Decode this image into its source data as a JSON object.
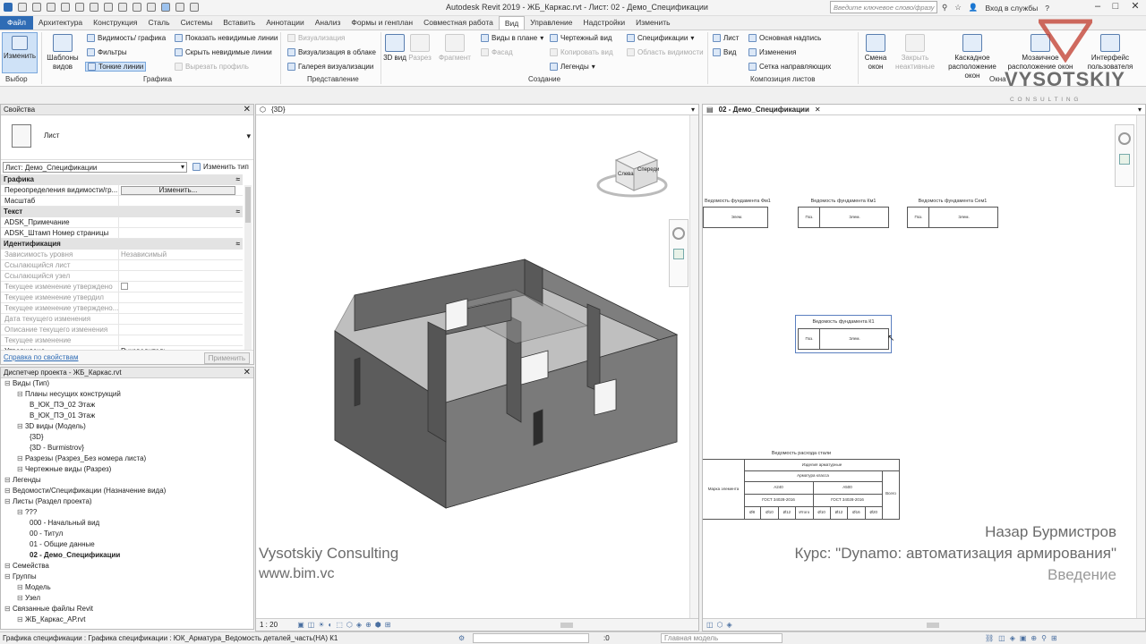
{
  "titlebar": {
    "title": "Autodesk Revit 2019 - ЖБ_Каркас.rvt - Лист: 02 - Демо_Спецификации",
    "search_placeholder": "Введите ключевое слово/фразу",
    "signin": "Вход в службы",
    "help": "?"
  },
  "menu": {
    "tabs": [
      "Файл",
      "Архитектура",
      "Конструкция",
      "Сталь",
      "Системы",
      "Вставить",
      "Аннотации",
      "Анализ",
      "Формы и генплан",
      "Совместная работа",
      "Вид",
      "Управление",
      "Надстройки",
      "Изменить"
    ],
    "active_tab": "Вид"
  },
  "ribbon": {
    "select": {
      "modify": "Изменить",
      "label": "Выбор"
    },
    "graphics": {
      "templates": "Шаблоны видов",
      "visibility": "Видимость/ графика",
      "filters": "Фильтры",
      "thin_lines": "Тонкие линии",
      "show_hidden": "Показать невидимые линии",
      "hide_hidden": "Скрыть невидимые линии",
      "cut_profile": "Вырезать профиль",
      "label": "Графика"
    },
    "presentation": {
      "render": "Визуализация",
      "render_cloud": "Визуализация в облаке",
      "gallery": "Галерея визуализации",
      "label": "Представление"
    },
    "create": {
      "view3d": "3D вид",
      "section": "Разрез",
      "callout": "Фрагмент",
      "plan_views": "Виды в плане",
      "elevation": "Фасад",
      "drafting": "Чертежный вид",
      "duplicate": "Копировать вид",
      "legends": "Легенды",
      "schedules": "Спецификации",
      "scope_box": "Область видимости",
      "label": "Создание"
    },
    "sheet_composition": {
      "sheet": "Лист",
      "view": "Вид",
      "title_block": "Основная надпись",
      "revisions": "Изменения",
      "guide_grid": "Сетка направляющих",
      "label": "Композиция листов"
    },
    "windows": {
      "switch": "Смена окон",
      "close_inactive": "Закрыть неактивные",
      "cascade": "Каскадное расположение окон",
      "tile": "Мозаичное расположение окон",
      "ui": "Интерфейс пользователя",
      "label": "Окна"
    }
  },
  "properties": {
    "title": "Свойства",
    "type_name": "Лист",
    "selector": "Лист: Демо_Спецификации",
    "edit_type": "Изменить тип",
    "categories": {
      "graphics": "Графика",
      "text": "Текст",
      "identity": "Идентификация"
    },
    "rows_graphics": [
      {
        "k": "Переопределения видимости/гр...",
        "v": "Изменить..."
      },
      {
        "k": "Масштаб",
        "v": ""
      }
    ],
    "rows_text": [
      {
        "k": "ADSK_Примечание",
        "v": ""
      },
      {
        "k": "ADSK_Штамп Номер страницы",
        "v": ""
      }
    ],
    "rows_identity": [
      {
        "k": "Зависимость уровня",
        "v": "Независимый"
      },
      {
        "k": "Ссылающийся лист",
        "v": ""
      },
      {
        "k": "Ссылающийся узел",
        "v": ""
      },
      {
        "k": "Текущее изменение утверждено",
        "v": ""
      },
      {
        "k": "Текущее изменение утвердил",
        "v": ""
      },
      {
        "k": "Текущее изменение утверждено...",
        "v": ""
      },
      {
        "k": "Дата текущего изменения",
        "v": ""
      },
      {
        "k": "Описание текущего изменения",
        "v": ""
      },
      {
        "k": "Текущее изменение",
        "v": ""
      },
      {
        "k": "Утверждено",
        "v": "Руководитель"
      }
    ],
    "help_link": "Справка по свойствам",
    "apply": "Применить"
  },
  "browser": {
    "title": "Диспетчер проекта - ЖБ_Каркас.rvt",
    "rows": [
      {
        "label": "Виды (Тип)",
        "level": 0,
        "bold": false
      },
      {
        "label": "Планы несущих конструкций",
        "level": 1,
        "bold": false
      },
      {
        "label": "В_ЮК_ПЭ_02 Этаж",
        "level": 2,
        "bold": false
      },
      {
        "label": "В_ЮК_ПЭ_01 Этаж",
        "level": 2,
        "bold": false
      },
      {
        "label": "3D виды (Модель)",
        "level": 1,
        "bold": false
      },
      {
        "label": "{3D}",
        "level": 2,
        "bold": false
      },
      {
        "label": "{3D - Burmistrov}",
        "level": 2,
        "bold": false
      },
      {
        "label": "Разрезы (Разрез_Без номера листа)",
        "level": 1,
        "bold": false
      },
      {
        "label": "Чертежные виды (Разрез)",
        "level": 1,
        "bold": false
      },
      {
        "label": "Легенды",
        "level": 0,
        "bold": false
      },
      {
        "label": "Ведомости/Спецификации (Назначение вида)",
        "level": 0,
        "bold": false
      },
      {
        "label": "Листы (Раздел проекта)",
        "level": 0,
        "bold": false
      },
      {
        "label": "???",
        "level": 1,
        "bold": false
      },
      {
        "label": "000 - Начальный вид",
        "level": 2,
        "bold": false
      },
      {
        "label": "00 - Титул",
        "level": 2,
        "bold": false
      },
      {
        "label": "01 - Общие данные",
        "level": 2,
        "bold": false
      },
      {
        "label": "02 - Демо_Спецификации",
        "level": 2,
        "bold": true
      },
      {
        "label": "Семейства",
        "level": 0,
        "bold": false
      },
      {
        "label": "Группы",
        "level": 0,
        "bold": false
      },
      {
        "label": "Модель",
        "level": 1,
        "bold": false
      },
      {
        "label": "Узел",
        "level": 1,
        "bold": false
      },
      {
        "label": "Связанные файлы Revit",
        "level": 0,
        "bold": false
      },
      {
        "label": "ЖБ_Каркас_АР.rvt",
        "level": 1,
        "bold": false
      }
    ]
  },
  "view3d": {
    "tab": "{3D}",
    "scale": "1 : 20",
    "cube_left": "Слева",
    "cube_front": "Спереди"
  },
  "sheet": {
    "tab": "02 - Демо_Спецификации",
    "schedules": [
      {
        "title": "Ведомость фундамента Фм1",
        "c1": "",
        "c2": "Элем."
      },
      {
        "title": "Ведомость фундамента Км1",
        "c1": "Поз.",
        "c2": "Элем."
      },
      {
        "title": "Ведомость фундамента Сем1",
        "c1": "Поз.",
        "c2": "Элем."
      },
      {
        "title": "Ведомость фундамента К1",
        "c1": "Поз.",
        "c2": "Элем."
      }
    ],
    "big_table_title": "Ведомость расхода стали",
    "big_table": {
      "row1": "Изделия арматурные",
      "row2": "Арматура класса",
      "left": "Марка элемента",
      "right": "Всего",
      "g1": "А240",
      "g2": "А500",
      "sub1": "ГОСТ 34028-2016",
      "sub2": "ГОСТ 34028-2016",
      "cols": [
        "Ø8",
        "Ø10",
        "Ø12",
        "Итого",
        "Ø10",
        "Ø12",
        "Ø16",
        "Ø20"
      ]
    }
  },
  "watermark": {
    "company": "Vysotskiy Consulting",
    "site": "www.bim.vc",
    "author": "Назар Бурмистров",
    "course": "Курс: \"Dynamo: автоматизация армирования\"",
    "section": "Введение",
    "logo": "VYSOTSKIY",
    "logo_sub": "C O N S U L T I N G"
  },
  "status": {
    "text": "Графика спецификации : Графика спецификации : ЮК_Арматура_Ведомость деталей_часть(НА) К1",
    "zero": ":0",
    "model": "Главная модель"
  },
  "colors": {
    "accent": "#2f6cb5",
    "logo": "#c0392b"
  }
}
